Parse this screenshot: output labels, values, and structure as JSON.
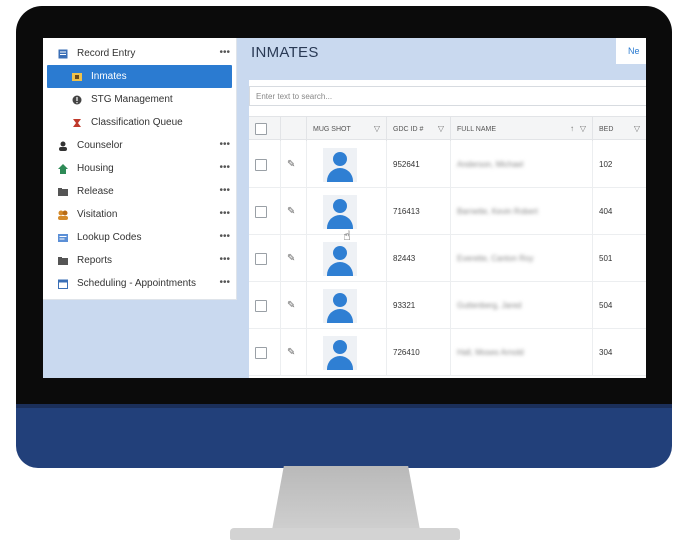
{
  "sidebar": {
    "items": [
      {
        "label": "Record Entry",
        "icon": "record-entry-icon",
        "more": "•••"
      },
      {
        "label": "Inmates",
        "icon": "inmates-icon",
        "more": ""
      },
      {
        "label": "STG Management",
        "icon": "stg-icon",
        "more": ""
      },
      {
        "label": "Classification Queue",
        "icon": "classification-icon",
        "more": ""
      },
      {
        "label": "Counselor",
        "icon": "counselor-icon",
        "more": "•••"
      },
      {
        "label": "Housing",
        "icon": "housing-icon",
        "more": "•••"
      },
      {
        "label": "Release",
        "icon": "release-icon",
        "more": "•••"
      },
      {
        "label": "Visitation",
        "icon": "visitation-icon",
        "more": "•••"
      },
      {
        "label": "Lookup Codes",
        "icon": "lookup-icon",
        "more": "•••"
      },
      {
        "label": "Reports",
        "icon": "reports-icon",
        "more": "•••"
      },
      {
        "label": "Scheduling - Appointments",
        "icon": "scheduling-icon",
        "more": "•••"
      }
    ]
  },
  "main": {
    "title": "INMATES",
    "new_label": "Ne",
    "search_placeholder": "Enter text to search..."
  },
  "table": {
    "headers": {
      "mug_shot": "MUG SHOT",
      "gdc_id": "GDC ID #",
      "full_name": "FULL NAME",
      "bed": "BED"
    },
    "rows": [
      {
        "gdc_id": "952641",
        "full_name": "Anderson, Michael",
        "bed": "102"
      },
      {
        "gdc_id": "716413",
        "full_name": "Barnette, Kevin Robert",
        "bed": "404"
      },
      {
        "gdc_id": "82443",
        "full_name": "Everette, Canton Roy",
        "bed": "501"
      },
      {
        "gdc_id": "93321",
        "full_name": "Guttenberg, Jared",
        "bed": "504"
      },
      {
        "gdc_id": "726410",
        "full_name": "Hall, Moses Arnold",
        "bed": "304"
      }
    ]
  },
  "colors": {
    "bezel": "#22407a",
    "active": "#2b7bd1",
    "screen_bg": "#c9d9ef"
  }
}
